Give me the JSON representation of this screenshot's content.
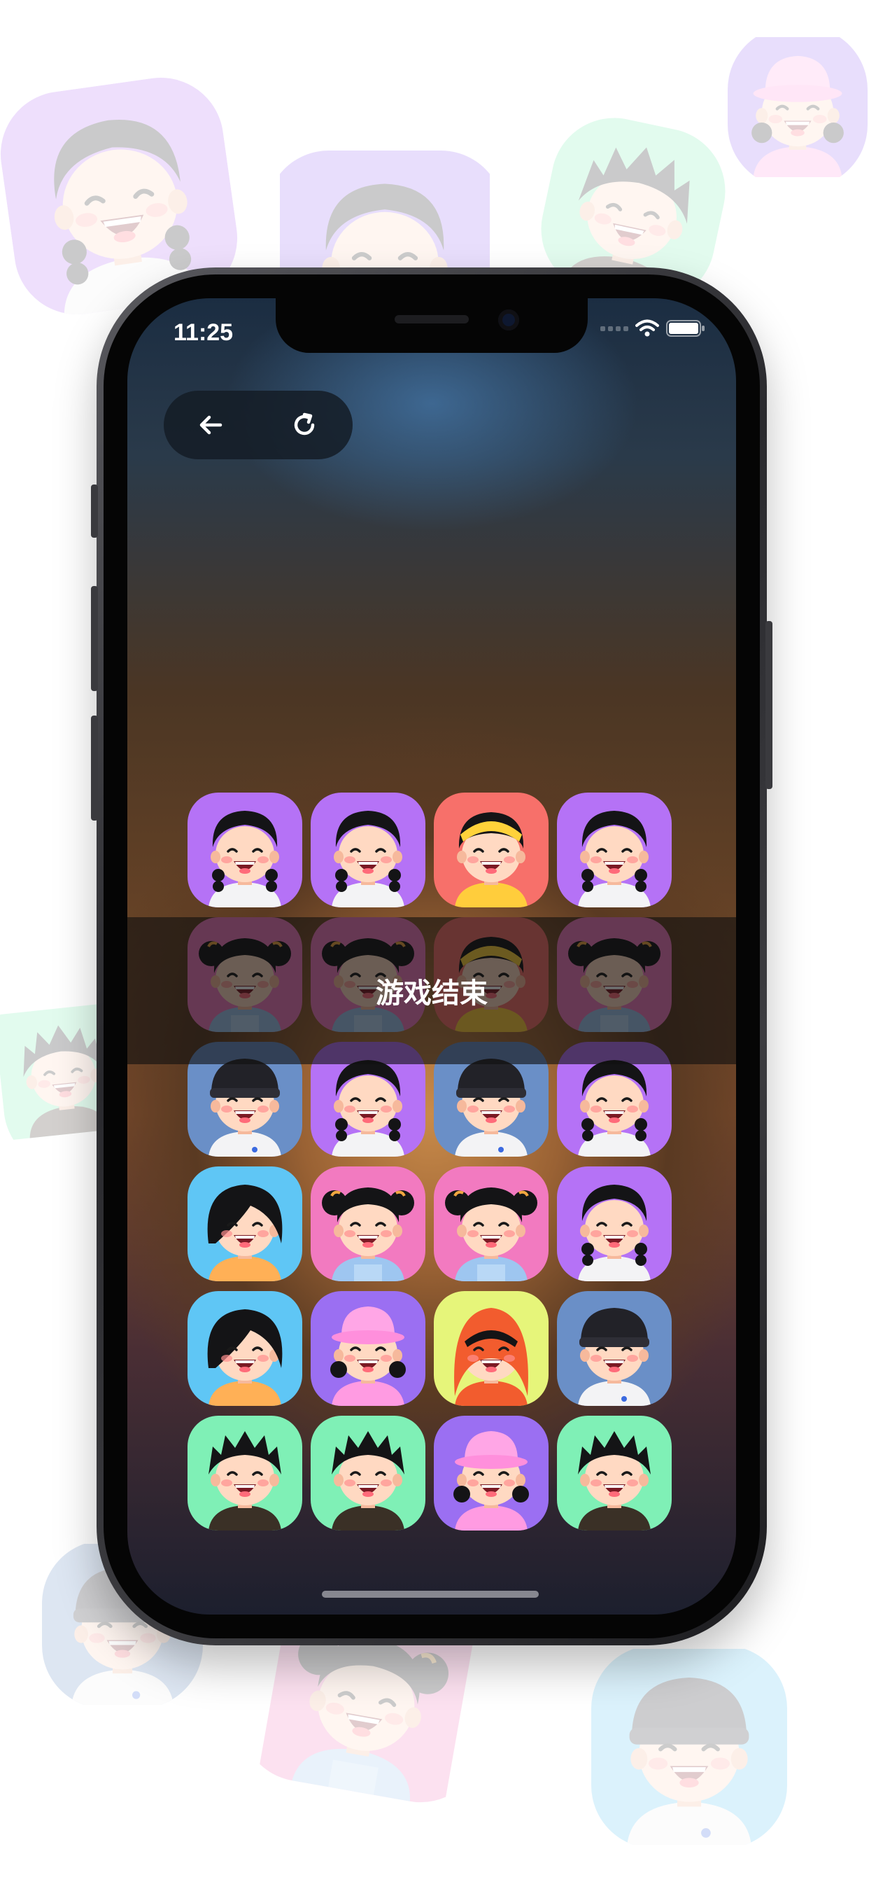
{
  "status_bar": {
    "time": "11:25"
  },
  "toolbar": {
    "back_icon": "arrow-left-icon",
    "refresh_icon": "refresh-icon"
  },
  "overlay": {
    "text": "游戏结束"
  },
  "colors": {
    "purple": "#b572f6",
    "pink": "#f27ac0",
    "coral": "#f7706a",
    "steel": "#6a8fc7",
    "sky": "#5fc6f5",
    "violet": "#9b6ff2",
    "lime": "#e6f57a",
    "mint": "#7ff0b6"
  },
  "grid": [
    [
      {
        "avatar": "girl-braids",
        "color": "purple"
      },
      {
        "avatar": "girl-braids",
        "color": "purple"
      },
      {
        "avatar": "girl-headband",
        "color": "coral"
      },
      {
        "avatar": "girl-braids",
        "color": "purple"
      }
    ],
    [
      {
        "avatar": "girl-pigtails",
        "color": "pink"
      },
      {
        "avatar": "girl-pigtails",
        "color": "pink"
      },
      {
        "avatar": "girl-headband",
        "color": "coral"
      },
      {
        "avatar": "girl-pigtails",
        "color": "pink"
      }
    ],
    [
      {
        "avatar": "boy-beanie",
        "color": "steel"
      },
      {
        "avatar": "girl-braids",
        "color": "purple"
      },
      {
        "avatar": "boy-beanie",
        "color": "steel"
      },
      {
        "avatar": "girl-braids",
        "color": "purple"
      }
    ],
    [
      {
        "avatar": "girl-bob",
        "color": "sky"
      },
      {
        "avatar": "girl-pigtails",
        "color": "pink"
      },
      {
        "avatar": "girl-pigtails",
        "color": "pink"
      },
      {
        "avatar": "girl-braids",
        "color": "purple"
      }
    ],
    [
      {
        "avatar": "girl-bob",
        "color": "sky"
      },
      {
        "avatar": "girl-bucket-hat",
        "color": "violet"
      },
      {
        "avatar": "girl-hijab",
        "color": "lime"
      },
      {
        "avatar": "boy-beanie",
        "color": "steel"
      }
    ],
    [
      {
        "avatar": "boy-spiky",
        "color": "mint"
      },
      {
        "avatar": "boy-spiky",
        "color": "mint"
      },
      {
        "avatar": "girl-bucket-hat",
        "color": "violet"
      },
      {
        "avatar": "boy-spiky",
        "color": "mint"
      }
    ]
  ],
  "background_tiles": [
    {
      "avatar": "girl-braids",
      "color": "purple"
    },
    {
      "avatar": "girl-braids",
      "color": "violet"
    },
    {
      "avatar": "boy-spiky",
      "color": "mint"
    },
    {
      "avatar": "girl-bucket-hat",
      "color": "violet"
    },
    {
      "avatar": "boy-spiky",
      "color": "mint"
    },
    {
      "avatar": "boy-beanie",
      "color": "steel"
    },
    {
      "avatar": "girl-pigtails",
      "color": "pink"
    },
    {
      "avatar": "boy-beanie",
      "color": "sky"
    }
  ]
}
